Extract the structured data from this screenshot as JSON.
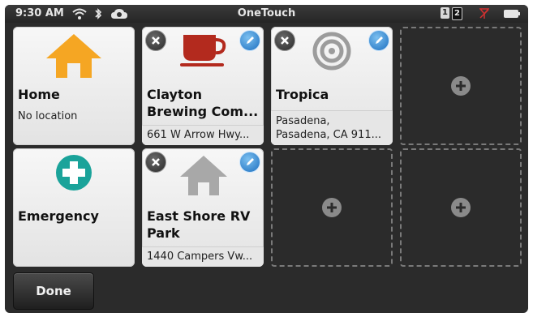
{
  "status_bar": {
    "time": "9:30 AM",
    "title": "OneTouch",
    "sim1": "1",
    "sim2": "2",
    "icons": [
      "wifi-icon",
      "bluetooth-icon",
      "cloud-sync-icon",
      "no-signal-icon",
      "battery-icon"
    ]
  },
  "tiles": [
    {
      "name": "Home",
      "subtitle": "No location",
      "icon": "home-icon",
      "icon_color": "#f5a623",
      "deletable": false,
      "editable": false
    },
    {
      "name_line1": "Clayton",
      "name_line2": "Brewing Com...",
      "address": "661 W Arrow Hwy...",
      "icon": "coffee-cup-icon",
      "icon_color": "#b32a1e",
      "deletable": true,
      "editable": true
    },
    {
      "name": "Tropica",
      "address_line1": "Pasadena,",
      "address_line2": "Pasadena, CA 911...",
      "icon": "target-icon",
      "icon_color": "#9c9c9c",
      "deletable": true,
      "editable": true
    },
    {
      "name": "Emergency",
      "icon": "medical-plus-icon",
      "icon_color": "#1aa39a",
      "deletable": false,
      "editable": false
    },
    {
      "name_line1": "East Shore RV",
      "name_line2": "Park",
      "address": "1440 Campers Vw...",
      "icon": "home-icon",
      "icon_color": "#a8a8a8",
      "deletable": true,
      "editable": true
    }
  ],
  "empty_slots": 3,
  "done_label": "Done",
  "colors": {
    "background": "#2b2b2b",
    "tile": "#f2f2f2",
    "edit_badge": "#2a7fd4",
    "delete_badge": "#3a3a3a"
  }
}
